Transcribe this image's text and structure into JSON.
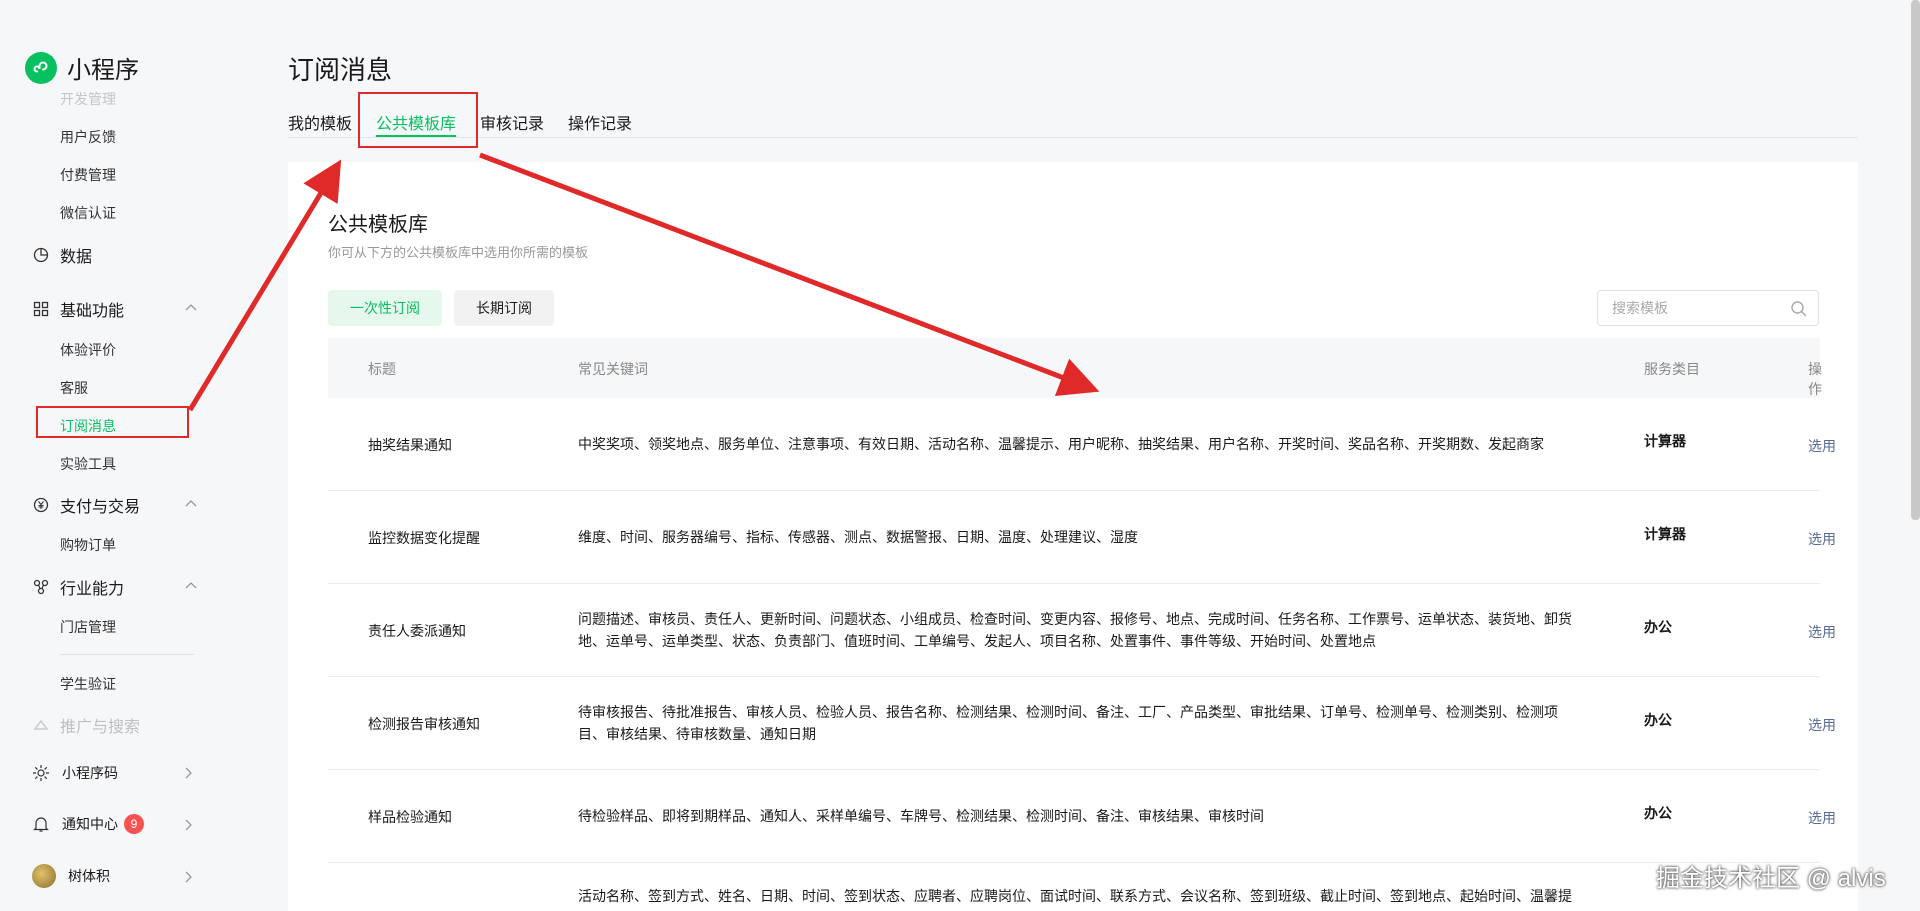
{
  "app": {
    "name": "小程序"
  },
  "sidebar": {
    "partial_item": "开发管理",
    "subitems_dev": [
      "用户反馈",
      "付费管理",
      "微信认证"
    ],
    "data_label": "数据",
    "basic": {
      "label": "基础功能",
      "items": [
        "体验评价",
        "客服",
        "订阅消息",
        "实验工具"
      ]
    },
    "pay": {
      "label": "支付与交易",
      "items": [
        "购物订单"
      ]
    },
    "industry": {
      "label": "行业能力",
      "items": [
        "门店管理",
        "学生验证"
      ]
    },
    "promo_label": "推广与搜索",
    "qrcode_label": "小程序码",
    "notify": {
      "label": "通知中心",
      "count": "9"
    },
    "user": {
      "name": "树体积"
    }
  },
  "page": {
    "title": "订阅消息"
  },
  "tabs": [
    "我的模板",
    "公共模板库",
    "审核记录",
    "操作记录"
  ],
  "library": {
    "title": "公共模板库",
    "subtitle": "你可从下方的公共模板库中选用你所需的模板",
    "types": [
      "一次性订阅",
      "长期订阅"
    ],
    "search_placeholder": "搜索模板",
    "columns": [
      "标题",
      "常见关键词",
      "服务类目",
      "操作"
    ],
    "rows": [
      {
        "title": "抽奖结果通知",
        "keywords": "中奖奖项、领奖地点、服务单位、注意事项、有效日期、活动名称、温馨提示、用户昵称、抽奖结果、用户名称、开奖时间、奖品名称、开奖期数、发起商家",
        "category": "计算器",
        "action": "选用"
      },
      {
        "title": "监控数据变化提醒",
        "keywords": "维度、时间、服务器编号、指标、传感器、测点、数据警报、日期、温度、处理建议、湿度",
        "category": "计算器",
        "action": "选用"
      },
      {
        "title": "责任人委派通知",
        "keywords": "问题描述、审核员、责任人、更新时间、问题状态、小组成员、检查时间、变更内容、报修号、地点、完成时间、任务名称、工作票号、运单状态、装货地、卸货地、运单号、运单类型、状态、负责部门、值班时间、工单编号、发起人、项目名称、处置事件、事件等级、开始时间、处置地点",
        "category": "办公",
        "action": "选用"
      },
      {
        "title": "检测报告审核通知",
        "keywords": "待审核报告、待批准报告、审核人员、检验人员、报告名称、检测结果、检测时间、备注、工厂、产品类型、审批结果、订单号、检测单号、检测类别、检测项目、审核结果、待审核数量、通知日期",
        "category": "办公",
        "action": "选用"
      },
      {
        "title": "样品检验通知",
        "keywords": "待检验样品、即将到期样品、通知人、采样单编号、车牌号、检测结果、检测时间、备注、审核结果、审核时间",
        "category": "办公",
        "action": "选用"
      },
      {
        "title": "",
        "keywords": "活动名称、签到方式、姓名、日期、时间、签到状态、应聘者、应聘岗位、面试时间、联系方式、会议名称、签到班级、截止时间、签到地点、起始时间、温馨提",
        "category": "",
        "action": ""
      }
    ]
  },
  "watermark": "掘金技术社区 @ alvis",
  "colors": {
    "accent": "#07c160",
    "annotation": "#e02a2a",
    "link": "#576b95",
    "badge": "#fa5151"
  }
}
